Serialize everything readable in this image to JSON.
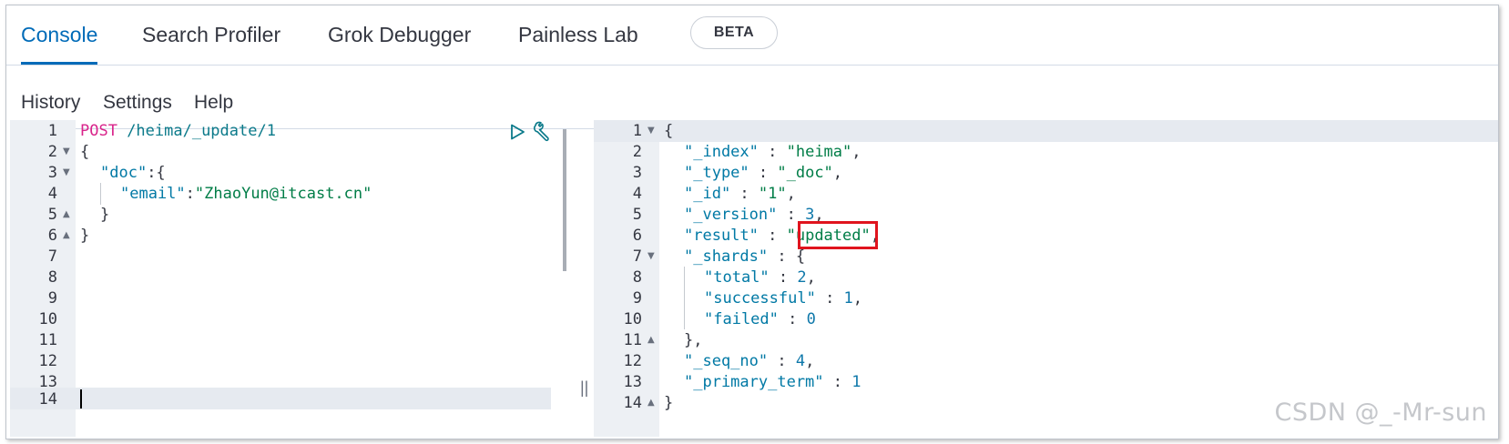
{
  "tabs": [
    {
      "label": "Console"
    },
    {
      "label": "Search Profiler"
    },
    {
      "label": "Grok Debugger"
    },
    {
      "label": "Painless Lab"
    }
  ],
  "beta_badge": "BETA",
  "menu": {
    "history": "History",
    "settings": "Settings",
    "help": "Help"
  },
  "request": {
    "line_numbers": [
      "1",
      "2",
      "3",
      "4",
      "5",
      "6",
      "7",
      "8",
      "9",
      "10",
      "11",
      "12",
      "13",
      "14"
    ],
    "method": "POST",
    "path": " /heima/_update/1",
    "lines": {
      "l2": "{",
      "l3_key": "\"doc\"",
      "l3_rest": ":{",
      "l4_key": "\"email\"",
      "l4_colon": ":",
      "l4_val": "\"ZhaoYun@itcast.cn\"",
      "l5": "}",
      "l6": "}"
    }
  },
  "response": {
    "line_numbers": [
      "1",
      "2",
      "3",
      "4",
      "5",
      "6",
      "7",
      "8",
      "9",
      "10",
      "11",
      "12",
      "13",
      "14"
    ],
    "lines": [
      {
        "key": "",
        "sep": "",
        "val": "",
        "tail": "{"
      },
      {
        "key": "\"_index\"",
        "sep": " : ",
        "val": "\"heima\"",
        "tail": ","
      },
      {
        "key": "\"_type\"",
        "sep": " : ",
        "val": "\"_doc\"",
        "tail": ","
      },
      {
        "key": "\"_id\"",
        "sep": " : ",
        "val": "\"1\"",
        "tail": ","
      },
      {
        "key": "\"_version\"",
        "sep": " : ",
        "val": "3",
        "tail": ","
      },
      {
        "key": "\"result\"",
        "sep": " : ",
        "val": "\"updated\"",
        "tail": ","
      },
      {
        "key": "\"_shards\"",
        "sep": " : ",
        "val": "",
        "tail": "{"
      },
      {
        "key": "\"total\"",
        "sep": " : ",
        "val": "2",
        "tail": ","
      },
      {
        "key": "\"successful\"",
        "sep": " : ",
        "val": "1",
        "tail": ","
      },
      {
        "key": "\"failed\"",
        "sep": " : ",
        "val": "0",
        "tail": ""
      },
      {
        "key": "",
        "sep": "",
        "val": "",
        "tail": "},"
      },
      {
        "key": "\"_seq_no\"",
        "sep": " : ",
        "val": "4",
        "tail": ","
      },
      {
        "key": "\"_primary_term\"",
        "sep": " : ",
        "val": "1",
        "tail": ""
      },
      {
        "key": "",
        "sep": "",
        "val": "",
        "tail": "}"
      }
    ]
  },
  "icons": {
    "run": "play-icon",
    "settings": "wrench-icon",
    "resize": "resize-handle-icon"
  },
  "highlight_color": "#e0141e",
  "watermark": "CSDN @_-Mr-sun"
}
